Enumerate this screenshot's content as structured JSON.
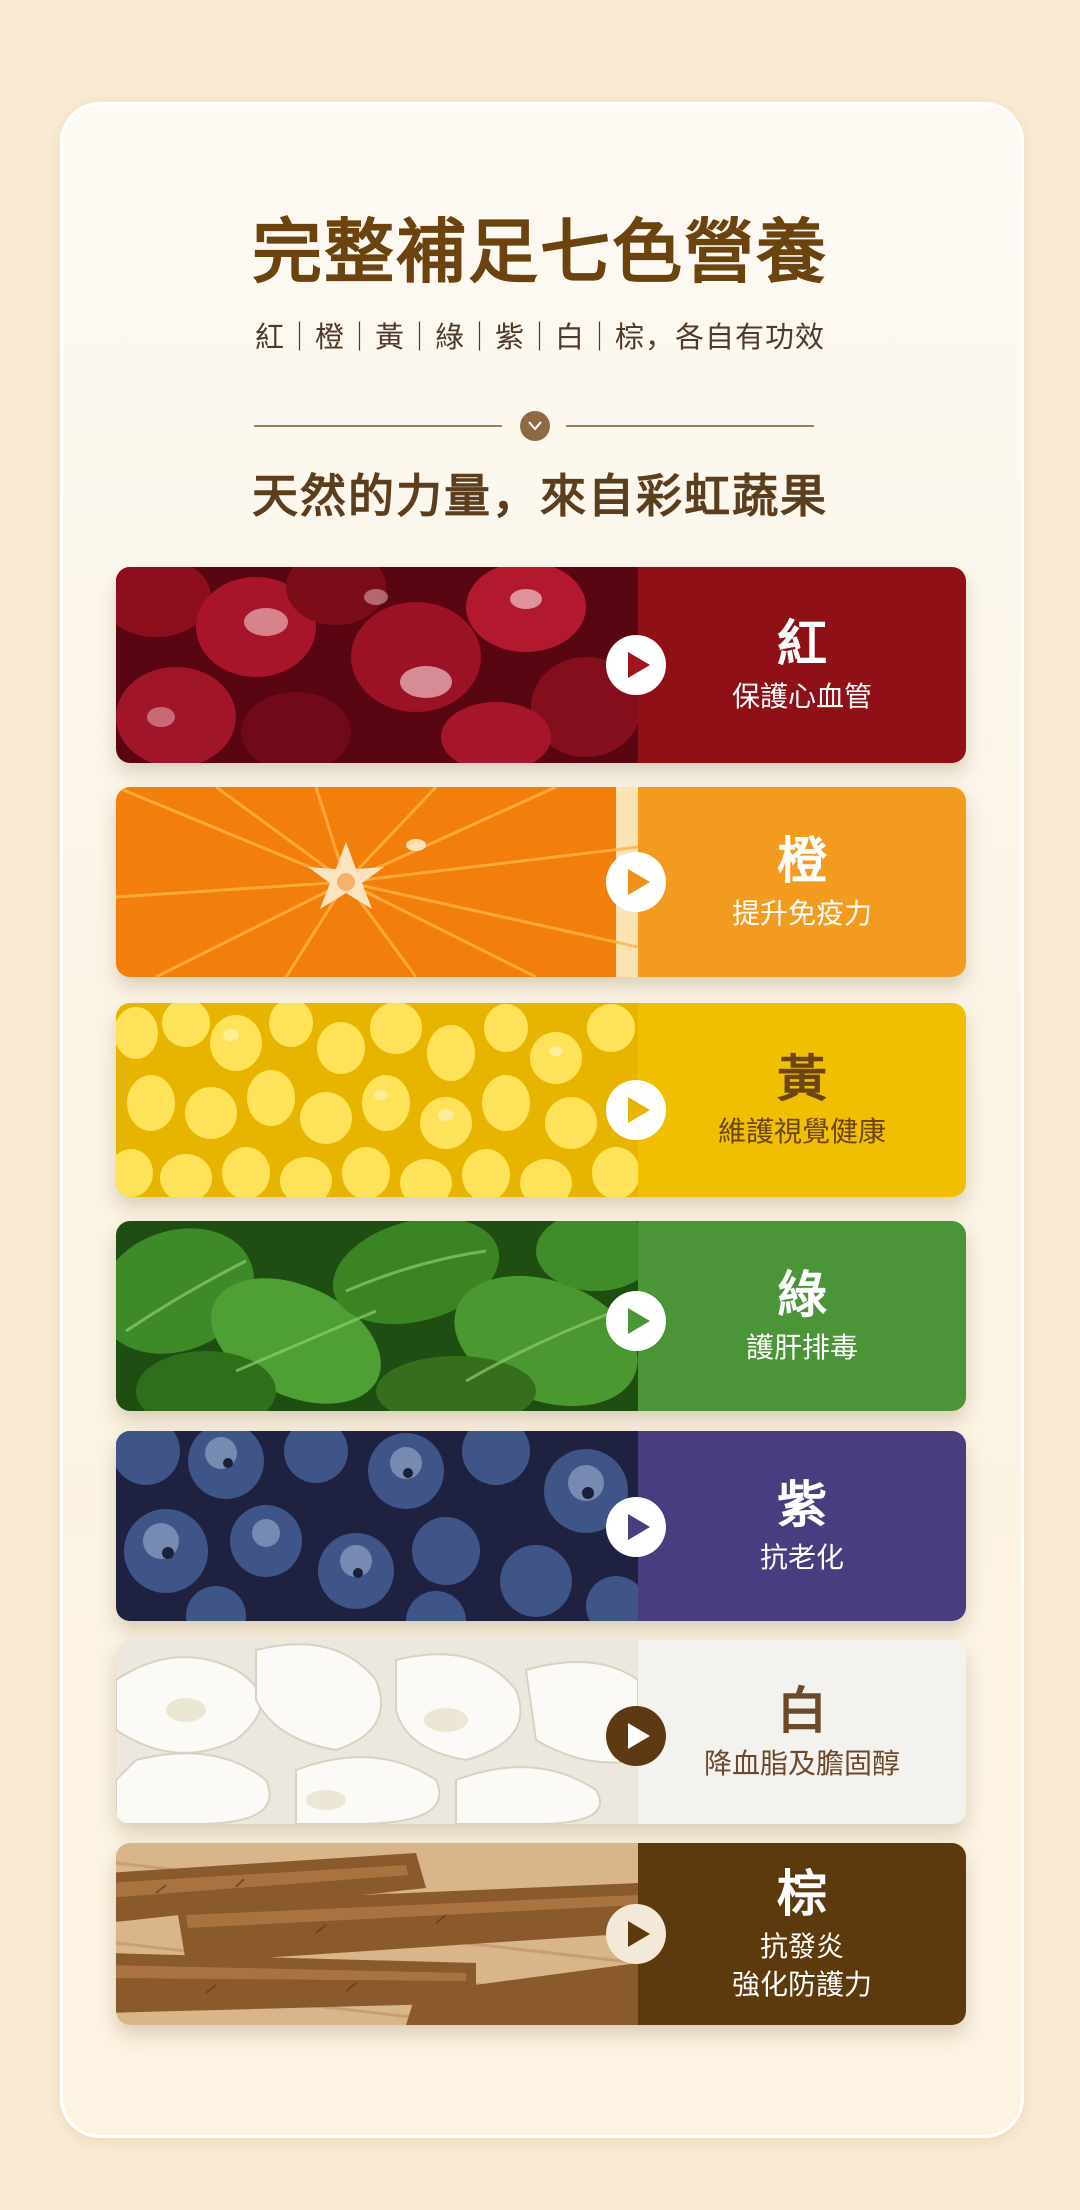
{
  "header": {
    "title": "完整補足七色營養",
    "subtitle": "紅｜橙｜黃｜綠｜紫｜白｜棕，各自有功效",
    "headline": "天然的力量，來自彩虹蔬果",
    "divider_icon": "chevron-down-icon"
  },
  "colors": [
    {
      "name": "紅",
      "desc": [
        "保護心血管"
      ],
      "bg": "#8f1016",
      "fg": "#ffffff",
      "play_bg": "#ffffff",
      "play_fg": "#a3141b",
      "photo": "pomegranate-seeds"
    },
    {
      "name": "橙",
      "desc": [
        "提升免疫力"
      ],
      "bg": "#f39b1e",
      "fg": "#ffffff",
      "play_bg": "#ffffff",
      "play_fg": "#f0901a",
      "photo": "orange-slice"
    },
    {
      "name": "黃",
      "desc": [
        "維護視覺健康"
      ],
      "bg": "#f0c000",
      "fg": "#6b4613",
      "play_bg": "#ffffff",
      "play_fg": "#e8b400",
      "photo": "corn-kernels"
    },
    {
      "name": "綠",
      "desc": [
        "護肝排毒"
      ],
      "bg": "#4b9538",
      "fg": "#ffffff",
      "play_bg": "#ffffff",
      "play_fg": "#4b9538",
      "photo": "green-leaves"
    },
    {
      "name": "紫",
      "desc": [
        "抗老化"
      ],
      "bg": "#493c7f",
      "fg": "#ffffff",
      "play_bg": "#ffffff",
      "play_fg": "#493c7f",
      "photo": "blueberries"
    },
    {
      "name": "白",
      "desc": [
        "降血脂及膽固醇"
      ],
      "bg": "#f4f2ef",
      "fg": "#6b4a2b",
      "play_bg": "#5d3914",
      "play_fg": "#ffffff",
      "photo": "white-fungus"
    },
    {
      "name": "棕",
      "desc": [
        "抗發炎",
        "強化防護力"
      ],
      "bg": "#5c3a0d",
      "fg": "#ffffff",
      "play_bg": "#f4e9d8",
      "play_fg": "#5c3a0d",
      "photo": "burdock-root"
    }
  ]
}
